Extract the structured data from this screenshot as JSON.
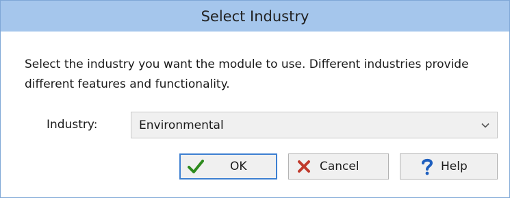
{
  "dialog": {
    "title": "Select Industry",
    "description": "Select the industry you want the module to use. Different industries provide different features and functionality.",
    "industry": {
      "label": "Industry:",
      "selected": "Environmental"
    },
    "buttons": {
      "ok": {
        "label": "OK",
        "icon": "checkmark-icon"
      },
      "cancel": {
        "label": "Cancel",
        "icon": "x-icon"
      },
      "help": {
        "label": "Help",
        "icon": "question-mark-icon"
      }
    }
  },
  "colors": {
    "titlebar": "#a5c6ec",
    "window_border": "#7ea7d6",
    "default_button_border": "#3c7fd1",
    "ok_icon": "#2e8b1e",
    "cancel_icon": "#c0392b",
    "help_icon": "#1e5fbf"
  }
}
